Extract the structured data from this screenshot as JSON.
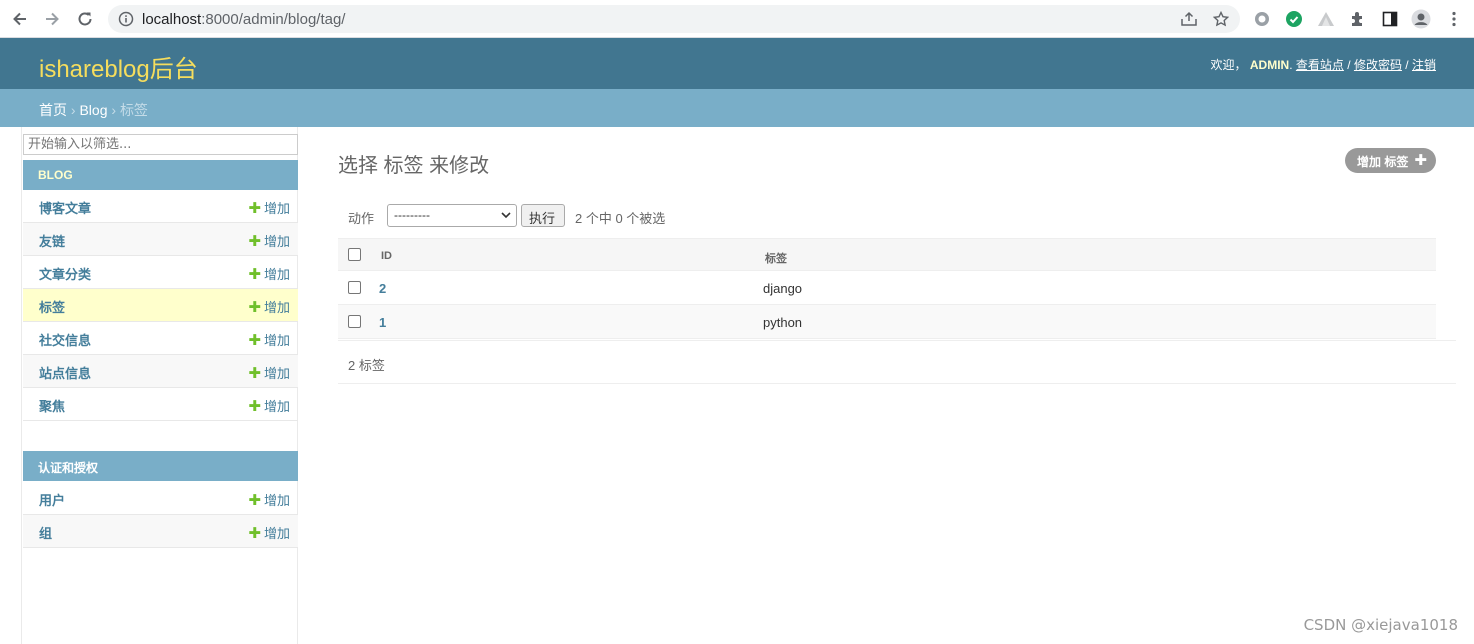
{
  "browser": {
    "url_host": "localhost",
    "url_path": ":8000/admin/blog/tag/"
  },
  "header": {
    "brand": "ishareblog后台",
    "welcome": "欢迎，",
    "user": "ADMIN",
    "view_site": "查看站点",
    "change_password": "修改密码",
    "logout": "注销",
    "sep": "/"
  },
  "breadcrumbs": {
    "home": "首页",
    "app": "Blog",
    "current": "标签"
  },
  "sidebar": {
    "filter_placeholder": "开始输入以筛选...",
    "blog_caption": "BLOG",
    "blog_models": [
      {
        "name": "博客文章",
        "add": "增加"
      },
      {
        "name": "友链",
        "add": "增加"
      },
      {
        "name": "文章分类",
        "add": "增加"
      },
      {
        "name": "标签",
        "add": "增加"
      },
      {
        "name": "社交信息",
        "add": "增加"
      },
      {
        "name": "站点信息",
        "add": "增加"
      },
      {
        "name": "聚焦",
        "add": "增加"
      }
    ],
    "auth_caption": "认证和授权",
    "auth_models": [
      {
        "name": "用户",
        "add": "增加"
      },
      {
        "name": "组",
        "add": "增加"
      }
    ]
  },
  "content": {
    "title": "选择 标签 来修改",
    "add_button": "增加 标签",
    "action_label": "动作",
    "action_selected": "---------",
    "go_button": "执行",
    "counter": "2 个中 0 个被选",
    "columns": [
      "ID",
      "标签"
    ],
    "rows": [
      {
        "id": "2",
        "tag": "django"
      },
      {
        "id": "1",
        "tag": "python"
      }
    ],
    "paginator": "2 标签"
  },
  "watermark": "CSDN @xiejava1018",
  "colors": {
    "header": "#417690",
    "breadcrumbs": "#79aec8",
    "brand": "#f5dd5d",
    "link": "#447e9b",
    "add_plus": "#70bf2b"
  }
}
